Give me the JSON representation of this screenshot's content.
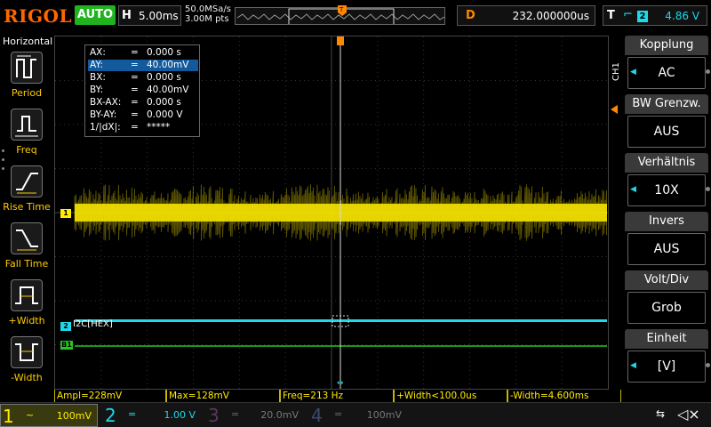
{
  "brand": "RIGOL",
  "run_state": "AUTO",
  "horizontal": {
    "tag": "H",
    "timebase": "5.00ms"
  },
  "acquisition": {
    "sample_rate": "50.0MSa/s",
    "memory_depth": "3.00M pts"
  },
  "delay": {
    "tag": "D",
    "value": "232.000000us"
  },
  "trigger": {
    "tag": "T",
    "source": "2",
    "level": "4.86 V"
  },
  "left_menu": {
    "title": "Horizontal",
    "items": [
      {
        "label": "Period",
        "icon": "period-icon"
      },
      {
        "label": "Freq",
        "icon": "frequency-icon"
      },
      {
        "label": "Rise Time",
        "icon": "rise-time-icon"
      },
      {
        "label": "Fall Time",
        "icon": "fall-time-icon"
      },
      {
        "label": "+Width",
        "icon": "positive-width-icon"
      },
      {
        "label": "-Width",
        "icon": "negative-width-icon"
      }
    ]
  },
  "cursor_readout": [
    {
      "key": "AX:",
      "eq": "=",
      "value": "0.000 s"
    },
    {
      "key": "AY:",
      "eq": "=",
      "value": "40.00mV"
    },
    {
      "key": "BX:",
      "eq": "=",
      "value": "0.000 s"
    },
    {
      "key": "BY:",
      "eq": "=",
      "value": "40.00mV"
    },
    {
      "key": "BX-AX:",
      "eq": "=",
      "value": "0.000 s"
    },
    {
      "key": "BY-AY:",
      "eq": "=",
      "value": "0.000 V"
    },
    {
      "key": "1/|dX|:",
      "eq": "=",
      "value": "*****"
    }
  ],
  "traces": {
    "ch1_marker": "1",
    "ch2_marker": "2",
    "ch2_decode_label": "I2C[HEX]",
    "bus_marker": "B1"
  },
  "right_menu": {
    "channel": "CH1",
    "items": [
      {
        "title": "Kopplung",
        "value": "AC"
      },
      {
        "title": "BW Grenzw.",
        "value": "AUS"
      },
      {
        "title": "Verhältnis",
        "value": "10X"
      },
      {
        "title": "Invers",
        "value": "AUS"
      },
      {
        "title": "Volt/Div",
        "value": "Grob"
      },
      {
        "title": "Einheit",
        "value": "[V]"
      }
    ]
  },
  "measurements": [
    "Ampl=228mV",
    "Max=128mV",
    "Freq=213 Hz",
    "+Width<100.0us",
    "-Width=4.600ms"
  ],
  "channels": [
    {
      "num": "1",
      "coupling": "~",
      "scale": "100mV",
      "color": "#ffec00",
      "active": true
    },
    {
      "num": "2",
      "coupling": "=",
      "scale": "1.00 V",
      "color": "#1fd8e8",
      "active": false
    },
    {
      "num": "3",
      "coupling": "=",
      "scale": "20.0mV",
      "color": "#c040c0",
      "active": false
    },
    {
      "num": "4",
      "coupling": "=",
      "scale": "100mV",
      "color": "#5080ff",
      "active": false
    }
  ],
  "colors": {
    "ch1": "#ffec00",
    "ch2": "#1fd8e8",
    "bus": "#22c822",
    "brand": "#ff6600",
    "run": "#1fb41f"
  }
}
